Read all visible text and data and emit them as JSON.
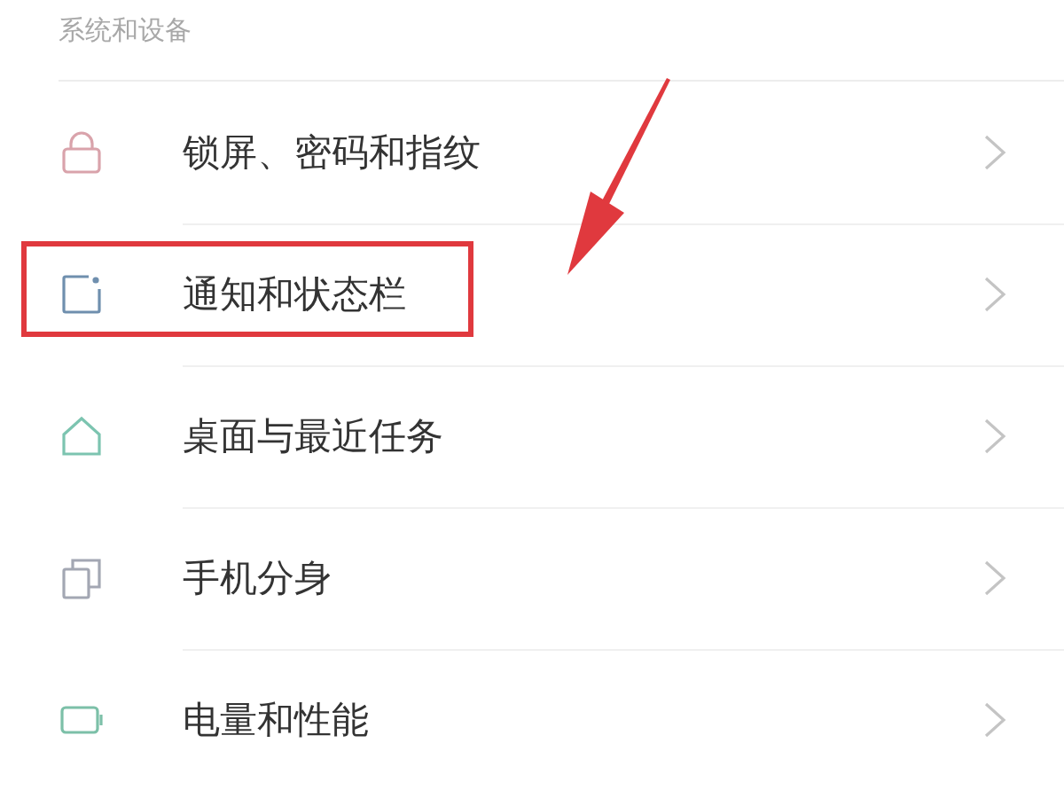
{
  "section_header": "系统和设备",
  "items": [
    {
      "label": "锁屏、密码和指纹",
      "kind": "lock",
      "color": "#d9a3ab",
      "highlighted": false
    },
    {
      "label": "通知和状态栏",
      "kind": "notification",
      "color": "#6f8fae",
      "highlighted": true
    },
    {
      "label": "桌面与最近任务",
      "kind": "home",
      "color": "#7cc4b0",
      "highlighted": false
    },
    {
      "label": "手机分身",
      "kind": "clone",
      "color": "#a3a7b3",
      "highlighted": false
    },
    {
      "label": "电量和性能",
      "kind": "battery",
      "color": "#7cc0a8",
      "highlighted": false
    }
  ],
  "annotation": {
    "kind": "arrow"
  }
}
